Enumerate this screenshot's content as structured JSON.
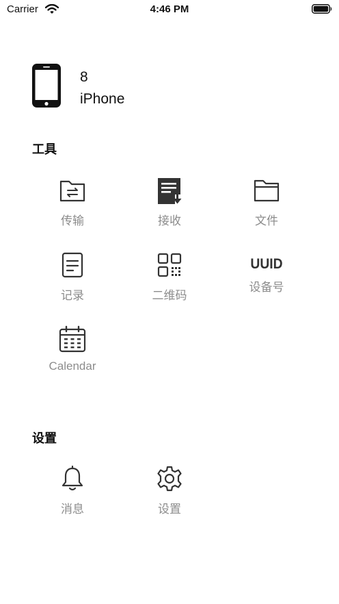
{
  "status_bar": {
    "carrier": "Carrier",
    "time": "4:46 PM"
  },
  "device": {
    "model": "8",
    "name": "iPhone"
  },
  "tools": {
    "title": "工具",
    "items": [
      {
        "icon": "folder-transfer-icon",
        "label": "传输"
      },
      {
        "icon": "receive-document-icon",
        "label": "接收"
      },
      {
        "icon": "folder-icon",
        "label": "文件"
      },
      {
        "icon": "document-list-icon",
        "label": "记录"
      },
      {
        "icon": "qr-code-icon",
        "label": "二维码"
      },
      {
        "icon": "uuid-icon",
        "icon_text": "UUID",
        "label": "设备号"
      },
      {
        "icon": "calendar-icon",
        "label": "Calendar"
      }
    ]
  },
  "settings": {
    "title": "设置",
    "items": [
      {
        "icon": "bell-icon",
        "label": "消息"
      },
      {
        "icon": "gear-icon",
        "label": "设置"
      }
    ]
  }
}
